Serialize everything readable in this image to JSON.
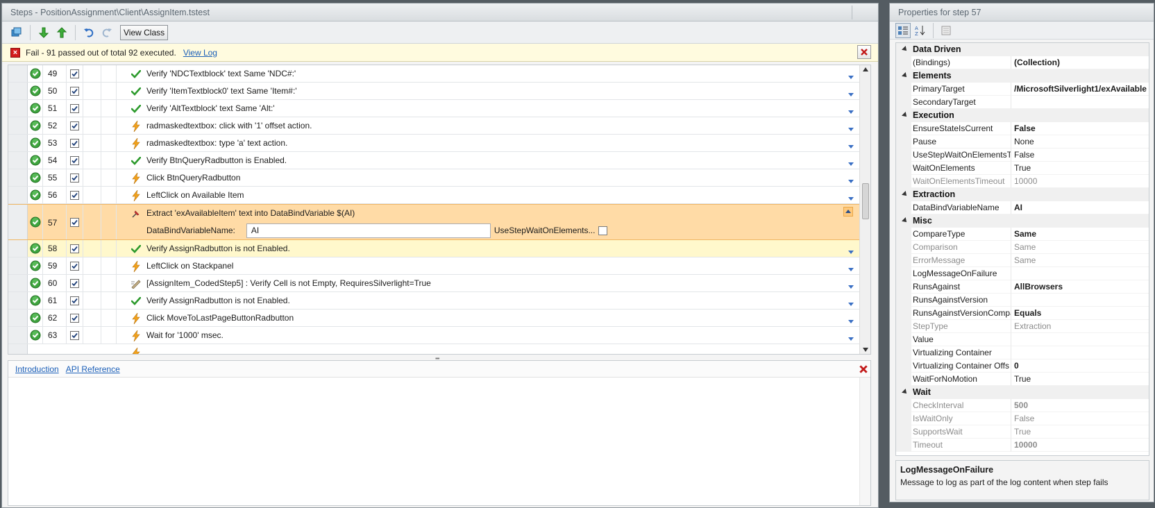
{
  "steps_panel": {
    "title": "Steps - PositionAssignment\\Client\\AssignItem.tstest",
    "view_class_label": "View Class"
  },
  "status": {
    "text": "Fail - 91 passed out of total 92 executed.",
    "view_log": "View Log"
  },
  "steps": [
    {
      "num": "49",
      "icon": "check",
      "text": "Verify 'NDCTextblock' text Same 'NDC#:'"
    },
    {
      "num": "50",
      "icon": "check",
      "text": "Verify 'ItemTextblock0' text Same 'Item#:'"
    },
    {
      "num": "51",
      "icon": "check",
      "text": "Verify 'AltTextblock' text Same 'Alt:'"
    },
    {
      "num": "52",
      "icon": "bolt",
      "text": "radmaskedtextbox: click with '1' offset action."
    },
    {
      "num": "53",
      "icon": "bolt",
      "text": "radmaskedtextbox: type 'a' text action."
    },
    {
      "num": "54",
      "icon": "check",
      "text": "Verify BtnQueryRadbutton is Enabled."
    },
    {
      "num": "55",
      "icon": "bolt",
      "text": "Click BtnQueryRadbutton"
    },
    {
      "num": "56",
      "icon": "bolt",
      "text": "LeftClick on Available Item"
    }
  ],
  "selected_step": {
    "num": "57",
    "text": "Extract 'exAvailableItem' text into DataBindVariable $(AI)",
    "field_label": "DataBindVariableName:",
    "field_value": "AI",
    "option_label": "UseStepWaitOnElements..."
  },
  "steps_after": [
    {
      "num": "58",
      "icon": "check",
      "text": "Verify AssignRadbutton is not Enabled.",
      "next": true
    },
    {
      "num": "59",
      "icon": "bolt",
      "text": "LeftClick on Stackpanel"
    },
    {
      "num": "60",
      "icon": "code",
      "text": "[AssignItem_CodedStep5] : Verify Cell is not Empty, RequiresSilverlight=True"
    },
    {
      "num": "61",
      "icon": "check",
      "text": "Verify AssignRadbutton is not Enabled."
    },
    {
      "num": "62",
      "icon": "bolt",
      "text": "Click MoveToLastPageButtonRadbutton"
    },
    {
      "num": "63",
      "icon": "bolt",
      "text": "Wait for '1000' msec."
    }
  ],
  "bottom_tabs": {
    "introduction": "Introduction",
    "api_reference": "API Reference"
  },
  "props_panel": {
    "title": "Properties for step 57"
  },
  "categories": [
    {
      "name": "Data Driven",
      "props": [
        {
          "name": "(Bindings)",
          "value": "(Collection)",
          "bold": true
        }
      ]
    },
    {
      "name": "Elements",
      "props": [
        {
          "name": "PrimaryTarget",
          "value": "/MicrosoftSilverlight1/exAvailable",
          "bold": true
        },
        {
          "name": "SecondaryTarget",
          "value": ""
        }
      ]
    },
    {
      "name": "Execution",
      "props": [
        {
          "name": "EnsureStateIsCurrent",
          "value": "False",
          "bold": true
        },
        {
          "name": "Pause",
          "value": "None"
        },
        {
          "name": "UseStepWaitOnElementsTi",
          "value": "False"
        },
        {
          "name": "WaitOnElements",
          "value": "True"
        },
        {
          "name": "WaitOnElementsTimeout",
          "value": "10000",
          "ro": true
        }
      ]
    },
    {
      "name": "Extraction",
      "props": [
        {
          "name": "DataBindVariableName",
          "value": "AI",
          "bold": true
        }
      ]
    },
    {
      "name": "Misc",
      "props": [
        {
          "name": "CompareType",
          "value": "Same",
          "bold": true
        },
        {
          "name": "Comparison",
          "value": "Same",
          "ro": true
        },
        {
          "name": "ErrorMessage",
          "value": "Same",
          "ro": true
        },
        {
          "name": "LogMessageOnFailure",
          "value": ""
        },
        {
          "name": "RunsAgainst",
          "value": "AllBrowsers",
          "bold": true
        },
        {
          "name": "RunsAgainstVersion",
          "value": ""
        },
        {
          "name": "RunsAgainstVersionCompa",
          "value": "Equals",
          "bold": true
        },
        {
          "name": "StepType",
          "value": "Extraction",
          "ro": true
        },
        {
          "name": "Value",
          "value": ""
        },
        {
          "name": "Virtualizing Container",
          "value": ""
        },
        {
          "name": "Virtualizing Container Offs",
          "value": "0",
          "bold": true
        },
        {
          "name": "WaitForNoMotion",
          "value": "True"
        }
      ]
    },
    {
      "name": "Wait",
      "props": [
        {
          "name": "CheckInterval",
          "value": "500",
          "bold": true,
          "ro": true
        },
        {
          "name": "IsWaitOnly",
          "value": "False",
          "ro": true
        },
        {
          "name": "SupportsWait",
          "value": "True",
          "ro": true
        },
        {
          "name": "Timeout",
          "value": "10000",
          "bold": true,
          "ro": true
        }
      ]
    }
  ],
  "description": {
    "title": "LogMessageOnFailure",
    "text": "Message to log as part of the log content when step fails"
  },
  "colors": {
    "selected_row": "#ffdba6",
    "next_row": "#fff8cc",
    "status_bg": "#fffbdf",
    "link": "#1b5fb8"
  }
}
